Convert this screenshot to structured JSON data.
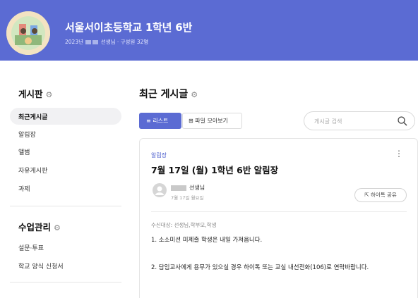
{
  "header": {
    "title": "서울서이초등학교 1학년 6반",
    "meta_prefix": "2023년",
    "meta_suffix": "선생님 · 구성원 32명"
  },
  "sidebar": {
    "board_heading": "게시판",
    "board_items": [
      {
        "label": "최근게시글",
        "active": true
      },
      {
        "label": "알림장"
      },
      {
        "label": "앨범"
      },
      {
        "label": "자유게시판"
      },
      {
        "label": "과제"
      }
    ],
    "class_heading": "수업관리",
    "class_items": [
      {
        "label": "설문·투표"
      },
      {
        "label": "학교 양식 신청서"
      }
    ]
  },
  "main": {
    "heading": "최근 게시글",
    "list_label": "리스트",
    "files_label": "파일 모아보기",
    "search_placeholder": "게시글 검색"
  },
  "post": {
    "category": "알림장",
    "title": "7월 17일 (월) 1학년 6반 알림장",
    "author": "선생님",
    "date": "7월 17일 월요일",
    "share_label": "하이톡 공유",
    "recipients": "수신대상: 선생님,학부모,학생",
    "line1": "1. 소소미션 미제출 학생은 내일 가져옵니다.",
    "line2": "2. 담임교사에게 용무가 있으실 경우 하이톡 또는 교실 내선전화(106)로 연락바랍니다."
  },
  "colors": {
    "accent": "#5b6bd3",
    "category": "#4a5ccc"
  }
}
